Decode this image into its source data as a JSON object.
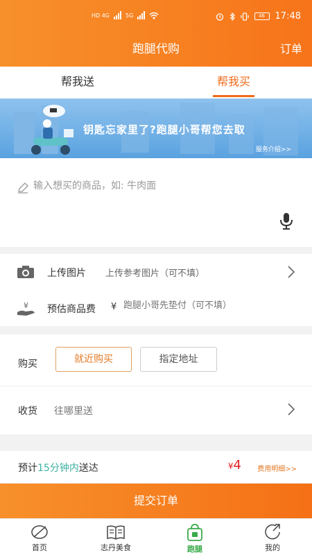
{
  "status_bar": {
    "network_left": "HD 4G",
    "network_right": "5G",
    "battery": "46",
    "time": "17:48"
  },
  "nav": {
    "title": "跑腿代购",
    "right_label": "订单"
  },
  "tabs": [
    {
      "label": "帮我送",
      "active": false
    },
    {
      "label": "帮我买",
      "active": true
    }
  ],
  "banner": {
    "headline": "钥匙忘家里了?跑腿小哥帮您去取",
    "link": "服务介绍>>"
  },
  "product_input": {
    "placeholder": "输入想买的商品，如: 牛肉面",
    "icon": "pencil-icon",
    "mic_icon": "microphone-icon"
  },
  "upload": {
    "label": "上传图片",
    "hint": "上传参考图片（可不填）",
    "icon": "camera-icon"
  },
  "price": {
    "label": "预估商品费",
    "currency": "¥",
    "hint": "跑腿小哥先垫付（可不填）",
    "icon": "money-hand-icon"
  },
  "buy": {
    "label": "购买",
    "options": [
      {
        "label": "就近购买",
        "selected": true
      },
      {
        "label": "指定地址",
        "selected": false
      }
    ]
  },
  "receive": {
    "label": "收货",
    "hint": "往哪里送"
  },
  "estimate": {
    "prefix": "预计",
    "highlight": "15分钟内",
    "suffix": "送达",
    "fee_currency": "¥",
    "fee": "4",
    "fee_link": "费用明细>>"
  },
  "submit_label": "提交订单",
  "tabbar": [
    {
      "label": "首页",
      "icon": "home-leaf-icon",
      "active": false
    },
    {
      "label": "志丹美食",
      "icon": "book-icon",
      "active": false
    },
    {
      "label": "跑腿",
      "icon": "shopping-bag-icon",
      "active": true
    },
    {
      "label": "我的",
      "icon": "profile-icon",
      "active": false
    }
  ],
  "colors": {
    "primary": "#f7801f",
    "accent_text": "#f06a1a",
    "highlight": "#3bb0a0",
    "fee": "#e02020",
    "tab_active": "#3aaa4a"
  }
}
